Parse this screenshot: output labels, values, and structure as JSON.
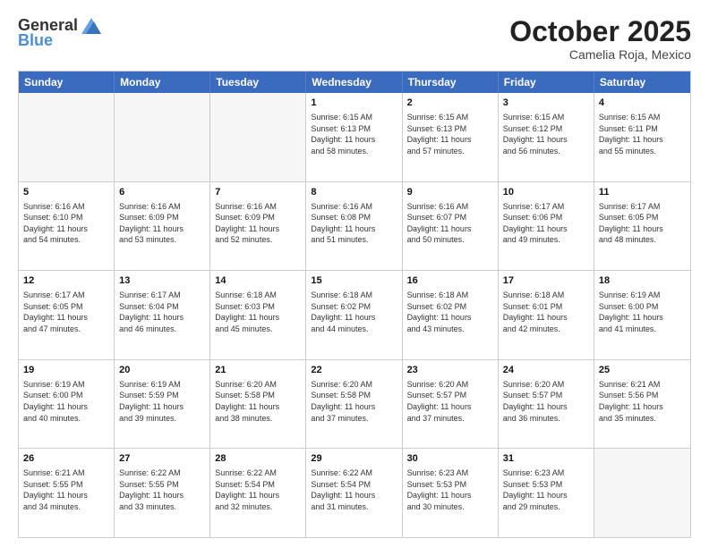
{
  "header": {
    "logo_general": "General",
    "logo_blue": "Blue",
    "month": "October 2025",
    "location": "Camelia Roja, Mexico"
  },
  "days_of_week": [
    "Sunday",
    "Monday",
    "Tuesday",
    "Wednesday",
    "Thursday",
    "Friday",
    "Saturday"
  ],
  "rows": [
    [
      {
        "day": "",
        "info": "",
        "empty": true
      },
      {
        "day": "",
        "info": "",
        "empty": true
      },
      {
        "day": "",
        "info": "",
        "empty": true
      },
      {
        "day": "1",
        "info": "Sunrise: 6:15 AM\nSunset: 6:13 PM\nDaylight: 11 hours\nand 58 minutes."
      },
      {
        "day": "2",
        "info": "Sunrise: 6:15 AM\nSunset: 6:13 PM\nDaylight: 11 hours\nand 57 minutes."
      },
      {
        "day": "3",
        "info": "Sunrise: 6:15 AM\nSunset: 6:12 PM\nDaylight: 11 hours\nand 56 minutes."
      },
      {
        "day": "4",
        "info": "Sunrise: 6:15 AM\nSunset: 6:11 PM\nDaylight: 11 hours\nand 55 minutes."
      }
    ],
    [
      {
        "day": "5",
        "info": "Sunrise: 6:16 AM\nSunset: 6:10 PM\nDaylight: 11 hours\nand 54 minutes."
      },
      {
        "day": "6",
        "info": "Sunrise: 6:16 AM\nSunset: 6:09 PM\nDaylight: 11 hours\nand 53 minutes."
      },
      {
        "day": "7",
        "info": "Sunrise: 6:16 AM\nSunset: 6:09 PM\nDaylight: 11 hours\nand 52 minutes."
      },
      {
        "day": "8",
        "info": "Sunrise: 6:16 AM\nSunset: 6:08 PM\nDaylight: 11 hours\nand 51 minutes."
      },
      {
        "day": "9",
        "info": "Sunrise: 6:16 AM\nSunset: 6:07 PM\nDaylight: 11 hours\nand 50 minutes."
      },
      {
        "day": "10",
        "info": "Sunrise: 6:17 AM\nSunset: 6:06 PM\nDaylight: 11 hours\nand 49 minutes."
      },
      {
        "day": "11",
        "info": "Sunrise: 6:17 AM\nSunset: 6:05 PM\nDaylight: 11 hours\nand 48 minutes."
      }
    ],
    [
      {
        "day": "12",
        "info": "Sunrise: 6:17 AM\nSunset: 6:05 PM\nDaylight: 11 hours\nand 47 minutes."
      },
      {
        "day": "13",
        "info": "Sunrise: 6:17 AM\nSunset: 6:04 PM\nDaylight: 11 hours\nand 46 minutes."
      },
      {
        "day": "14",
        "info": "Sunrise: 6:18 AM\nSunset: 6:03 PM\nDaylight: 11 hours\nand 45 minutes."
      },
      {
        "day": "15",
        "info": "Sunrise: 6:18 AM\nSunset: 6:02 PM\nDaylight: 11 hours\nand 44 minutes."
      },
      {
        "day": "16",
        "info": "Sunrise: 6:18 AM\nSunset: 6:02 PM\nDaylight: 11 hours\nand 43 minutes."
      },
      {
        "day": "17",
        "info": "Sunrise: 6:18 AM\nSunset: 6:01 PM\nDaylight: 11 hours\nand 42 minutes."
      },
      {
        "day": "18",
        "info": "Sunrise: 6:19 AM\nSunset: 6:00 PM\nDaylight: 11 hours\nand 41 minutes."
      }
    ],
    [
      {
        "day": "19",
        "info": "Sunrise: 6:19 AM\nSunset: 6:00 PM\nDaylight: 11 hours\nand 40 minutes."
      },
      {
        "day": "20",
        "info": "Sunrise: 6:19 AM\nSunset: 5:59 PM\nDaylight: 11 hours\nand 39 minutes."
      },
      {
        "day": "21",
        "info": "Sunrise: 6:20 AM\nSunset: 5:58 PM\nDaylight: 11 hours\nand 38 minutes."
      },
      {
        "day": "22",
        "info": "Sunrise: 6:20 AM\nSunset: 5:58 PM\nDaylight: 11 hours\nand 37 minutes."
      },
      {
        "day": "23",
        "info": "Sunrise: 6:20 AM\nSunset: 5:57 PM\nDaylight: 11 hours\nand 37 minutes."
      },
      {
        "day": "24",
        "info": "Sunrise: 6:20 AM\nSunset: 5:57 PM\nDaylight: 11 hours\nand 36 minutes."
      },
      {
        "day": "25",
        "info": "Sunrise: 6:21 AM\nSunset: 5:56 PM\nDaylight: 11 hours\nand 35 minutes."
      }
    ],
    [
      {
        "day": "26",
        "info": "Sunrise: 6:21 AM\nSunset: 5:55 PM\nDaylight: 11 hours\nand 34 minutes."
      },
      {
        "day": "27",
        "info": "Sunrise: 6:22 AM\nSunset: 5:55 PM\nDaylight: 11 hours\nand 33 minutes."
      },
      {
        "day": "28",
        "info": "Sunrise: 6:22 AM\nSunset: 5:54 PM\nDaylight: 11 hours\nand 32 minutes."
      },
      {
        "day": "29",
        "info": "Sunrise: 6:22 AM\nSunset: 5:54 PM\nDaylight: 11 hours\nand 31 minutes."
      },
      {
        "day": "30",
        "info": "Sunrise: 6:23 AM\nSunset: 5:53 PM\nDaylight: 11 hours\nand 30 minutes."
      },
      {
        "day": "31",
        "info": "Sunrise: 6:23 AM\nSunset: 5:53 PM\nDaylight: 11 hours\nand 29 minutes."
      },
      {
        "day": "",
        "info": "",
        "empty": true
      }
    ]
  ]
}
